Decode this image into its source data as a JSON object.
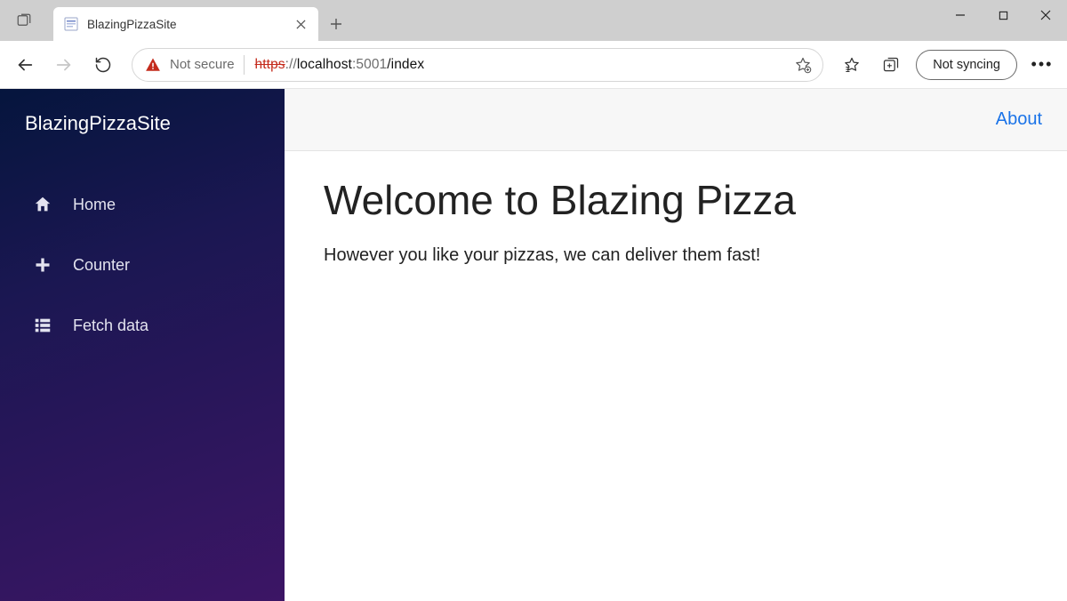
{
  "browser": {
    "tab_title": "BlazingPizzaSite",
    "not_secure_label": "Not secure",
    "url_https": "https",
    "url_sep": "://",
    "url_host": "localhost",
    "url_port": ":5001",
    "url_path": "/index",
    "sync_label": "Not syncing"
  },
  "sidebar": {
    "brand": "BlazingPizzaSite",
    "items": [
      {
        "label": "Home"
      },
      {
        "label": "Counter"
      },
      {
        "label": "Fetch data"
      }
    ]
  },
  "header": {
    "about": "About"
  },
  "page": {
    "heading": "Welcome to Blazing Pizza",
    "tagline": "However you like your pizzas, we can deliver them fast!"
  }
}
